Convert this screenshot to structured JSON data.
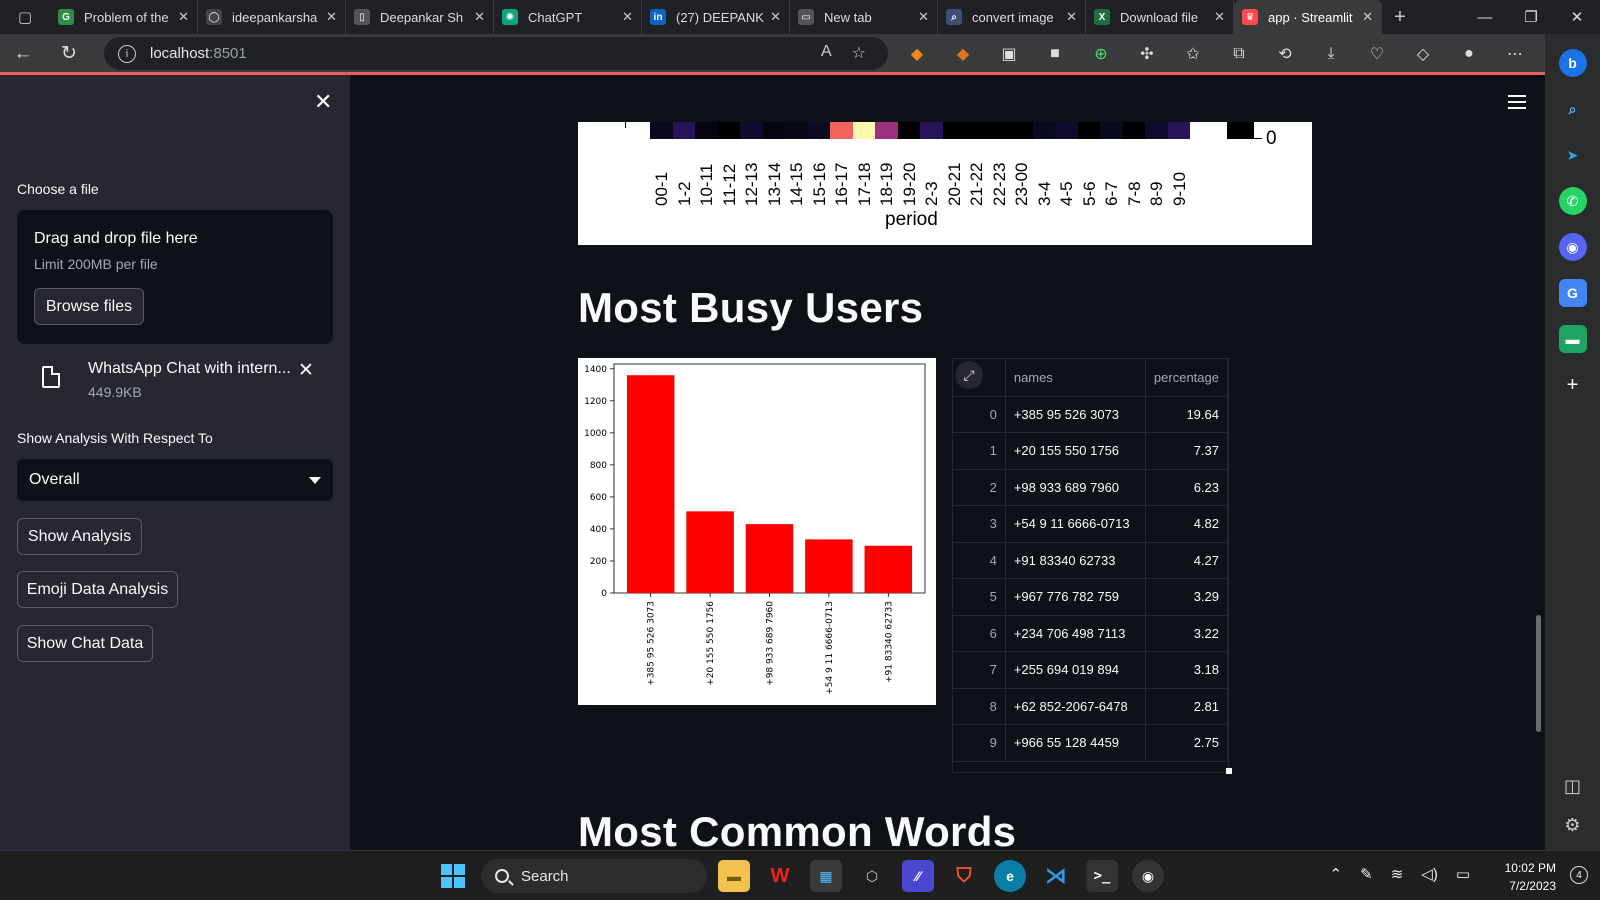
{
  "browser": {
    "tabs": [
      {
        "label": "Problem of the",
        "icon": "gfg-icon",
        "color": "#2f8d46",
        "glyph": "G",
        "active": false
      },
      {
        "label": "ideepankarsha",
        "icon": "github-icon",
        "color": "#444",
        "glyph": "◯",
        "active": false
      },
      {
        "label": "Deepankar Sh",
        "icon": "page-icon",
        "color": "#555",
        "glyph": "▯",
        "active": false
      },
      {
        "label": "ChatGPT",
        "icon": "chatgpt-icon",
        "color": "#10a37f",
        "glyph": "✺",
        "active": false
      },
      {
        "label": "(27) DEEPANK",
        "icon": "linkedin-icon",
        "color": "#0a66c2",
        "glyph": "in",
        "active": false
      },
      {
        "label": "New tab",
        "icon": "newtab-icon",
        "color": "#555",
        "glyph": "▭",
        "active": false
      },
      {
        "label": "convert image",
        "icon": "search-icon",
        "color": "#3c4f76",
        "glyph": "⌕",
        "active": false
      },
      {
        "label": "Download file",
        "icon": "excel-icon",
        "color": "#1d6f42",
        "glyph": "X",
        "active": false
      },
      {
        "label": "app · Streamlit",
        "icon": "streamlit-icon",
        "color": "#ff4b4b",
        "glyph": "♛",
        "active": true
      }
    ],
    "url_host": "localhost",
    "url_port": ":8501"
  },
  "sidebar": {
    "file_label": "Choose a file",
    "dropzone_title": "Drag and drop file here",
    "dropzone_limit": "Limit 200MB per file",
    "browse_label": "Browse files",
    "file_name": "WhatsApp Chat with intern...",
    "file_size": "449.9KB",
    "analysis_label": "Show Analysis With Respect To",
    "selected_user": "Overall",
    "show_analysis": "Show Analysis",
    "emoji_analysis": "Emoji Data Analysis",
    "show_chat": "Show Chat Data"
  },
  "main": {
    "busy_heading": "Most Busy Users",
    "words_heading": "Most Common Words",
    "table_headers": {
      "names": "names",
      "percentage": "percentage"
    }
  },
  "chart_data": [
    {
      "type": "heatmap",
      "xlabel": "period",
      "colorbar_label": "0",
      "categories": [
        "00-1",
        "1-2",
        "10-11",
        "11-12",
        "12-13",
        "13-14",
        "14-15",
        "15-16",
        "16-17",
        "17-18",
        "18-19",
        "19-20",
        "2-3",
        "20-21",
        "21-22",
        "22-23",
        "23-00",
        "3-4",
        "4-5",
        "5-6",
        "6-7",
        "7-8",
        "8-9",
        "9-10"
      ],
      "visible_row_colors": [
        "#0a0a1e",
        "#2a1459",
        "#050510",
        "#000000",
        "#120a2e",
        "#050510",
        "#080818",
        "#0c0a24",
        "#f4645c",
        "#fcf8b0",
        "#9c2f7f",
        "#000000",
        "#2a1459",
        "#000000",
        "#000000",
        "#000000",
        "#000000",
        "#0a0a1e",
        "#120a2e",
        "#000000",
        "#0a0a1e",
        "#000000",
        "#120a2e",
        "#2a1459"
      ]
    },
    {
      "type": "bar",
      "title": "",
      "xlabel": "",
      "ylabel": "",
      "categories": [
        "+385 95 526 3073",
        "+20 155 550 1756",
        "+98 933 689 7960",
        "+54 9 11 6666-0713",
        "+91 83340 62733"
      ],
      "values": [
        1360,
        510,
        430,
        335,
        295
      ],
      "ylim": [
        0,
        1430
      ],
      "yticks": [
        0,
        200,
        400,
        600,
        800,
        1000,
        1200,
        1400
      ],
      "color": "#ff0000"
    },
    {
      "type": "table",
      "columns": [
        "names",
        "percentage"
      ],
      "rows": [
        {
          "idx": "0",
          "name": "+385 95 526 3073",
          "pct": "19.64"
        },
        {
          "idx": "1",
          "name": "+20 155 550 1756",
          "pct": "7.37"
        },
        {
          "idx": "2",
          "name": "+98 933 689 7960",
          "pct": "6.23"
        },
        {
          "idx": "3",
          "name": "+54 9 11 6666-0713",
          "pct": "4.82"
        },
        {
          "idx": "4",
          "name": "+91 83340 62733",
          "pct": "4.27"
        },
        {
          "idx": "5",
          "name": "+967 776 782 759",
          "pct": "3.29"
        },
        {
          "idx": "6",
          "name": "+234 706 498 7113",
          "pct": "3.22"
        },
        {
          "idx": "7",
          "name": "+255 694 019 894",
          "pct": "3.18"
        },
        {
          "idx": "8",
          "name": "+62 852-2067-6478",
          "pct": "2.81"
        },
        {
          "idx": "9",
          "name": "+966 55 128 4459",
          "pct": "2.75"
        }
      ]
    }
  ],
  "taskbar": {
    "search_label": "Search",
    "time": "10:02 PM",
    "date": "7/2/2023",
    "notifications": "4"
  }
}
